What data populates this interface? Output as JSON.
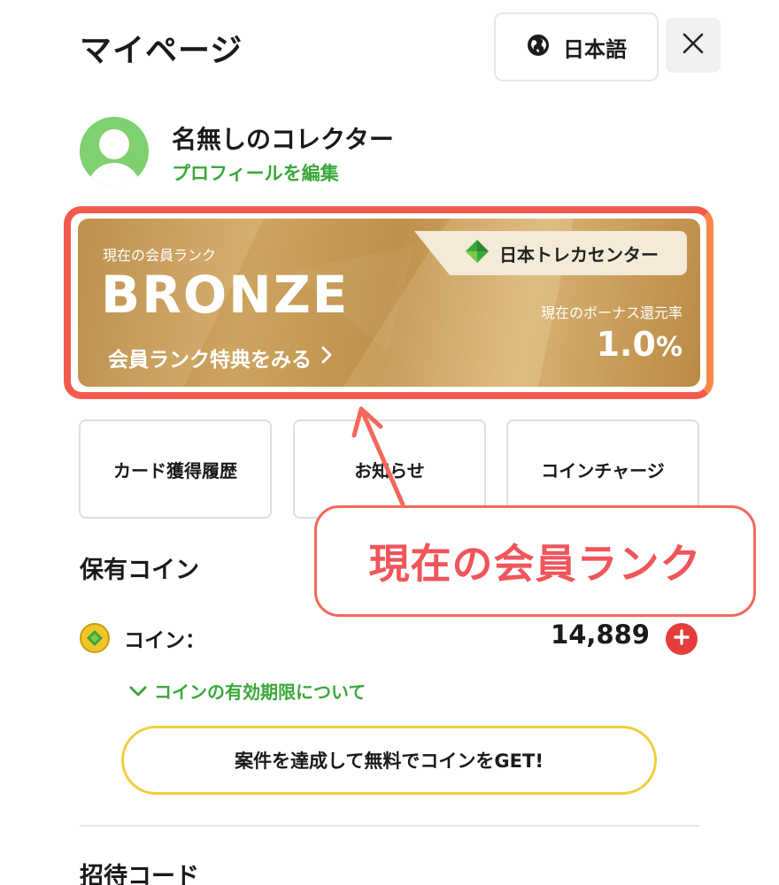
{
  "header": {
    "title": "マイページ",
    "language_label": "日本語"
  },
  "profile": {
    "name": "名無しのコレクター",
    "edit_label": "プロフィールを編集"
  },
  "rank_card": {
    "rank_label": "現在の会員ランク",
    "rank_name": "BRONZE",
    "benefits_label": "会員ランク特典をみる",
    "brand_name": "日本トレカセンター",
    "bonus_label": "現在のボーナス還元率",
    "bonus_value": "1.0",
    "bonus_unit": "%",
    "colors": {
      "card": "#c99d57",
      "outline": "#f35a4e",
      "brand_diamond": "#3aa83a"
    }
  },
  "menu_tiles": [
    {
      "label": "カード獲得履歴"
    },
    {
      "label": "お知らせ"
    },
    {
      "label": "コインチャージ"
    }
  ],
  "coins": {
    "section_title": "保有コイン",
    "coin_label": "コイン：",
    "count": "14,889",
    "expiry_link": "コインの有効期限について",
    "get_button": "案件を達成して無料でコインをGET!"
  },
  "invite": {
    "section_title": "招待コード"
  },
  "annotation": {
    "callout_text": "現在の会員ランク",
    "color": "#f0555a"
  },
  "icons": {
    "language": "globe-icon",
    "close": "close-icon",
    "avatar": "user-avatar-icon",
    "brand": "brand-diamond-icon",
    "coin": "coin-icon",
    "add": "plus-icon",
    "expiry": "chevron-down-icon",
    "benefits": "chevron-right-icon"
  }
}
